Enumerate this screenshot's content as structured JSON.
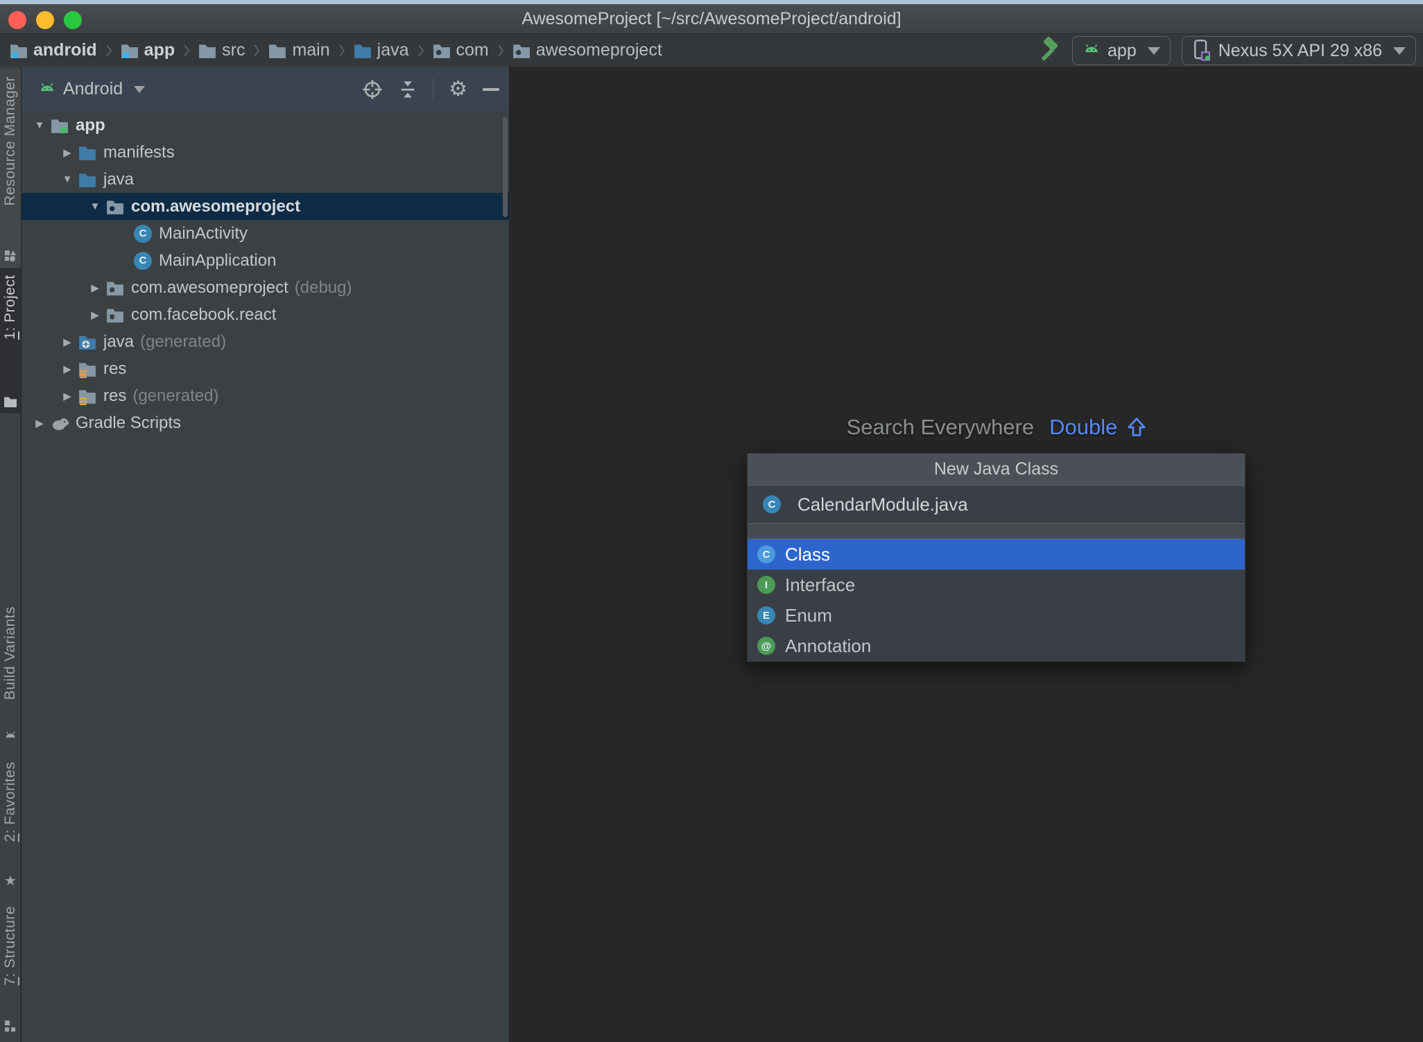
{
  "window": {
    "title": "AwesomeProject [~/src/AwesomeProject/android]",
    "traffic_lights": {
      "close": "#FF5F57",
      "minimize": "#FEBC2E",
      "zoom": "#28C840"
    }
  },
  "breadcrumbs": {
    "items": [
      {
        "label": "android",
        "icon": "module-folder-icon",
        "bold": true
      },
      {
        "label": "app",
        "icon": "module-folder-icon",
        "bold": true
      },
      {
        "label": "src",
        "icon": "folder-icon",
        "bold": false
      },
      {
        "label": "main",
        "icon": "folder-icon",
        "bold": false
      },
      {
        "label": "java",
        "icon": "source-folder-icon",
        "bold": false
      },
      {
        "label": "com",
        "icon": "package-icon",
        "bold": false
      },
      {
        "label": "awesomeproject",
        "icon": "package-icon",
        "bold": false
      }
    ]
  },
  "toolbar": {
    "build_icon": "hammer-icon",
    "run_config": {
      "label": "app",
      "icon": "android-icon"
    },
    "device": {
      "label": "Nexus 5X API 29 x86",
      "icon": "virtual-device-icon"
    }
  },
  "tool_window_bar": {
    "top": [
      {
        "key": "",
        "label": "Resource Manager",
        "icon": "shapes-icon",
        "active": false
      },
      {
        "key": "1",
        "label": ": Project",
        "icon": "project-folder-icon",
        "active": true
      }
    ],
    "bottom": [
      {
        "key": "",
        "label": "Build Variants",
        "icon": "android-head-icon"
      },
      {
        "key": "2",
        "label": ": Favorites",
        "icon": "star-icon"
      },
      {
        "key": "7",
        "label": ": Structure",
        "icon": "structure-icon"
      }
    ]
  },
  "project_panel": {
    "view_selector": {
      "label": "Android",
      "icon": "android-icon"
    },
    "header_actions": [
      "locate-icon",
      "collapse-all-icon",
      "settings-gear-icon",
      "hide-icon"
    ],
    "tree": [
      {
        "label": "app",
        "suffix": "",
        "icon": "module-folder-run-icon",
        "level": 0,
        "expand": "open",
        "selected": false,
        "bold": true
      },
      {
        "label": "manifests",
        "suffix": "",
        "icon": "source-folder-icon",
        "level": 1,
        "expand": "closed",
        "selected": false,
        "bold": false
      },
      {
        "label": "java",
        "suffix": "",
        "icon": "source-folder-icon",
        "level": 1,
        "expand": "open",
        "selected": false,
        "bold": false
      },
      {
        "label": "com.awesomeproject",
        "suffix": "",
        "icon": "package-icon",
        "level": 2,
        "expand": "open",
        "selected": true,
        "bold": true
      },
      {
        "label": "MainActivity",
        "suffix": "",
        "icon": "class-icon",
        "level": 3,
        "expand": "none",
        "selected": false,
        "bold": false
      },
      {
        "label": "MainApplication",
        "suffix": "",
        "icon": "class-icon",
        "level": 3,
        "expand": "none",
        "selected": false,
        "bold": false
      },
      {
        "label": "com.awesomeproject",
        "suffix": "(debug)",
        "icon": "package-icon",
        "level": 2,
        "expand": "closed",
        "selected": false,
        "bold": false
      },
      {
        "label": "com.facebook.react",
        "suffix": "",
        "icon": "package-icon",
        "level": 2,
        "expand": "closed",
        "selected": false,
        "bold": false
      },
      {
        "label": "java",
        "suffix": "(generated)",
        "icon": "generated-source-folder-icon",
        "level": 1,
        "expand": "closed",
        "selected": false,
        "bold": false
      },
      {
        "label": "res",
        "suffix": "",
        "icon": "res-folder-icon",
        "level": 1,
        "expand": "closed",
        "selected": false,
        "bold": false
      },
      {
        "label": "res",
        "suffix": "(generated)",
        "icon": "res-folder-icon",
        "level": 1,
        "expand": "closed",
        "selected": false,
        "bold": false
      },
      {
        "label": "Gradle Scripts",
        "suffix": "",
        "icon": "gradle-icon",
        "level": 0,
        "expand": "closed",
        "selected": false,
        "bold": false
      }
    ]
  },
  "editor": {
    "hint_text": "Search Everywhere",
    "hint_shortcut": "Double",
    "hint_shortcut_icon": "shift-arrow-icon"
  },
  "popup": {
    "title": "New Java Class",
    "file_name": "CalendarModule.java",
    "file_icon": "class-icon",
    "options": [
      {
        "label": "Class",
        "icon": "class-icon",
        "selected": true
      },
      {
        "label": "Interface",
        "icon": "interface-icon",
        "selected": false
      },
      {
        "label": "Enum",
        "icon": "enum-icon",
        "selected": false
      },
      {
        "label": "Annotation",
        "icon": "annotation-icon",
        "selected": false
      }
    ]
  },
  "colors": {
    "selection_blue": "#2E65CC",
    "tree_selection": "#0D2B45",
    "shortcut_blue": "#548AF7",
    "editor_bg": "#272727",
    "panel_bg": "#3B4043",
    "panel_header_bg": "#3A4450",
    "popup_header_bg": "#4B5056",
    "toolbar_bg": "#34383B"
  }
}
